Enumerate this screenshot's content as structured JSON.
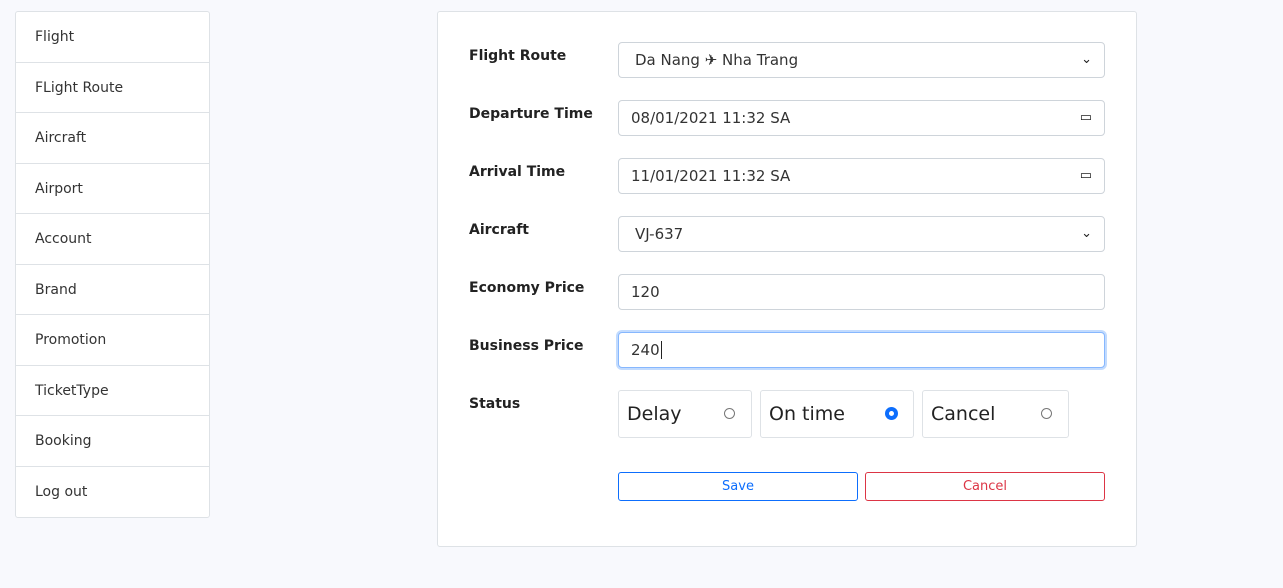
{
  "sidebar": {
    "items": [
      "Flight",
      "FLight Route",
      "Aircraft",
      "Airport",
      "Account",
      "Brand",
      "Promotion",
      "TicketType",
      "Booking",
      "Log out"
    ]
  },
  "form": {
    "flight_route": {
      "label": "Flight Route",
      "value": "Da Nang ✈ Nha Trang"
    },
    "departure_time": {
      "label": "Departure Time",
      "value": "08/01/2021 11:32 SA"
    },
    "arrival_time": {
      "label": "Arrival Time",
      "value": "11/01/2021 11:32 SA"
    },
    "aircraft": {
      "label": "Aircraft",
      "value": "VJ-637"
    },
    "economy_price": {
      "label": "Economy Price",
      "value": "120"
    },
    "business_price": {
      "label": "Business Price",
      "value": "240"
    },
    "status": {
      "label": "Status",
      "options": [
        "Delay",
        "On time",
        "Cancel"
      ],
      "selected": "On time"
    },
    "save_label": "Save",
    "cancel_label": "Cancel"
  },
  "colors": {
    "primary": "#0d6efd",
    "danger": "#dc3545"
  }
}
